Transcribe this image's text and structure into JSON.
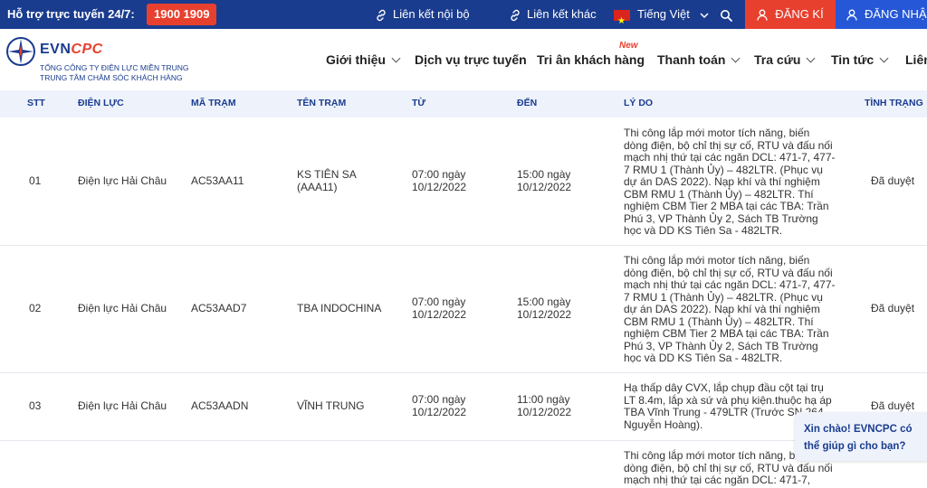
{
  "topbar": {
    "hotline_label": "Hỗ trợ trực tuyến 24/7:",
    "hotline_number": "1900 1909",
    "internal_link": "Liên kết nội bộ",
    "external_link": "Liên kết khác",
    "language": "Tiếng Việt",
    "register": "ĐĂNG KÍ",
    "login": "ĐĂNG NHẬP"
  },
  "header": {
    "logo_main": "EVN",
    "logo_accent": "CPC",
    "logo_sub1": "TỔNG CÔNG TY ĐIỆN LỰC MIỀN TRUNG",
    "logo_sub2": "TRUNG TÂM CHĂM SÓC KHÁCH HÀNG",
    "new_badge": "New",
    "nav": [
      "Giới thiệu",
      "Dịch vụ trực tuyến",
      "Tri ân khách hàng",
      "Thanh toán",
      "Tra cứu",
      "Tin tức",
      "Liên"
    ]
  },
  "table": {
    "headers": [
      "STT",
      "ĐIỆN LỰC",
      "MÃ TRẠM",
      "TÊN TRẠM",
      "TỪ",
      "ĐẾN",
      "LÝ DO",
      "TÌNH TRẠNG"
    ],
    "rows": [
      {
        "stt": "01",
        "dien_luc": "Điện lực Hải Châu",
        "ma_tram": "AC53AA11",
        "ten_tram": "KS TIÊN SA (AAA11)",
        "tu": "07:00 ngày 10/12/2022",
        "den": "15:00 ngày 10/12/2022",
        "ly_do": "Thi công lắp mới motor tích năng, biến dòng điện, bộ chỉ thị sự cố, RTU và đấu nối mạch nhị thứ tại các ngăn DCL: 471-7, 477-7 RMU 1 (Thành Ủy) – 482LTR. (Phục vụ dự án DAS 2022). Nạp khí và thí nghiệm CBM RMU 1 (Thành Ủy) – 482LTR. Thí nghiệm CBM Tier 2 MBA tại các TBA: Trần Phú 3, VP Thành Ủy 2, Sách TB Trường học và DD KS Tiên Sa - 482LTR.",
        "tinh_trang": "Đã duyệt"
      },
      {
        "stt": "02",
        "dien_luc": "Điện lực Hải Châu",
        "ma_tram": "AC53AAD7",
        "ten_tram": "TBA INDOCHINA",
        "tu": "07:00 ngày 10/12/2022",
        "den": "15:00 ngày 10/12/2022",
        "ly_do": "Thi công lắp mới motor tích năng, biến dòng điện, bộ chỉ thị sự cố, RTU và đấu nối mạch nhị thứ tại các ngăn DCL: 471-7, 477-7 RMU 1 (Thành Ủy) – 482LTR. (Phục vụ dự án DAS 2022). Nạp khí và thí nghiệm CBM RMU 1 (Thành Ủy) – 482LTR. Thí nghiệm CBM Tier 2 MBA tại các TBA: Trần Phú 3, VP Thành Ủy 2, Sách TB Trường học và DD KS Tiên Sa - 482LTR.",
        "tinh_trang": "Đã duyệt"
      },
      {
        "stt": "03",
        "dien_luc": "Điện lực Hải Châu",
        "ma_tram": "AC53AADN",
        "ten_tram": "VĨNH TRUNG",
        "tu": "07:00 ngày 10/12/2022",
        "den": "11:00 ngày 10/12/2022",
        "ly_do": "Hạ thấp dây CVX, lắp chụp đầu cột tại trụ LT 8.4m, lắp xà sứ và phụ kiện.thuộc hạ áp TBA Vĩnh Trung - 479LTR (Trước SN 264 Nguyễn Hoàng).",
        "tinh_trang": "Đã duyệt"
      },
      {
        "stt": "",
        "dien_luc": "",
        "ma_tram": "",
        "ten_tram": "",
        "tu": "",
        "den": "",
        "ly_do": "Thi công lắp mới motor tích năng, biến dòng điện, bộ chỉ thị sự cố, RTU và đấu nối mạch nhị thứ tại các ngăn DCL: 471-7,",
        "tinh_trang": ""
      }
    ]
  },
  "chat": {
    "message": "Xin chào! EVNCPC có thể giúp gì cho bạn?"
  },
  "colors": {
    "topbar": "#1a3c8f",
    "accent_red": "#e8402f",
    "login_blue": "#2657d6",
    "header_row": "#eef2fb"
  }
}
